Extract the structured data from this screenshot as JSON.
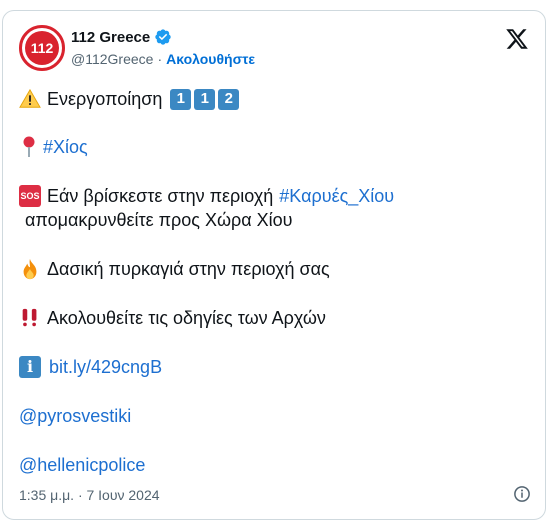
{
  "account": {
    "name": "112 Greece",
    "handle": "@112Greece",
    "separator": "·",
    "follow_label": "Ακολουθήστε",
    "avatar_text": "112"
  },
  "tweet": {
    "line1_text": "Ενεργοποίηση",
    "keycaps": [
      "1",
      "1",
      "2"
    ],
    "hashtag_chios": "#Χίος",
    "line3_text": "Εάν βρίσκεστε στην περιοχή",
    "hashtag_karyes": "#Καρυές_Χίου",
    "line3b_text": "απομακρυνθείτε προς Χώρα Χίου",
    "line4_text": "Δασική πυρκαγιά στην περιοχή σας",
    "line5_text": "Ακολουθείτε τις οδηγίες των Αρχών",
    "link": "bit.ly/429cngB",
    "mention1": "@pyrosvestiki",
    "mention2": "@hellenicpolice",
    "sos_label": "SOS",
    "info_label": "i"
  },
  "footer": {
    "timestamp": "1:35 μ.μ. · 7 Ιουν 2024"
  },
  "icons": {
    "warning": "warning-icon",
    "pin": "round-pushpin-icon",
    "fire": "fire-icon",
    "exclamation": "double-exclamation-icon",
    "x": "x-logo-icon",
    "verified": "verified-badge-icon",
    "info": "info-circle-icon"
  },
  "colors": {
    "link": "#1d6fd0",
    "follow": "#006fd6",
    "verified": "#1d9bf0",
    "brand_red": "#d9232e"
  }
}
